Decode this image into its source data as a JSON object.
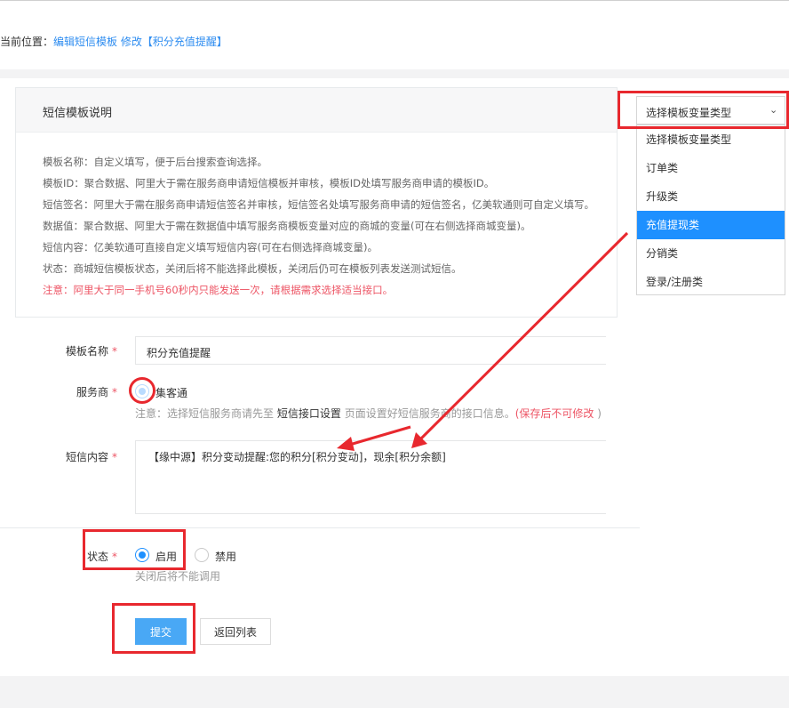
{
  "breadcrumb": {
    "prefix": "当前位置：",
    "path": "编辑短信模板 修改【积分充值提醒】"
  },
  "help": {
    "title": "短信模板说明",
    "lines": [
      "模板名称：自定义填写，便于后台搜索查询选择。",
      "模板ID：聚合数据、阿里大于需在服务商申请短信模板并审核，模板ID处填写服务商申请的模板ID。",
      "短信签名：阿里大于需在服务商申请短信签名并审核，短信签名处填写服务商申请的短信签名，亿美软通则可自定义填写。",
      "数据值：聚合数据、阿里大于需在数据值中填写服务商模板变量对应的商城的变量(可在右侧选择商城变量)。",
      "短信内容：亿美软通可直接自定义填写短信内容(可在右侧选择商城变量)。",
      "状态：商城短信模板状态，关闭后将不能选择此模板，关闭后仍可在模板列表发送测试短信。"
    ],
    "warning": "注意：阿里大于同一手机号60秒内只能发送一次，请根据需求选择适当接口。"
  },
  "variable_select": {
    "selected": "选择模板变量类型",
    "options": [
      "选择模板变量类型",
      "订单类",
      "升级类",
      "充值提现类",
      "分销类",
      "登录/注册类"
    ],
    "highlighted_option": "充值提现类"
  },
  "form": {
    "required_mark": "*",
    "name": {
      "label": "模板名称",
      "value": "积分充值提醒"
    },
    "provider": {
      "label": "服务商",
      "option": "集客通",
      "hint_prefix": "注意：选择短信服务商请先至",
      "hint_link": "短信接口设置",
      "hint_middle": "页面设置好短信服务商的接口信息。",
      "hint_warn": "(保存后不可修改",
      "hint_close": ")"
    },
    "content": {
      "label": "短信内容",
      "value": "【缘中源】积分变动提醒:您的积分[积分变动]，现余[积分余额]"
    },
    "status": {
      "label": "状态",
      "options": [
        "启用",
        "禁用"
      ],
      "selected": "启用",
      "hint": "关闭后将不能调用"
    }
  },
  "buttons": {
    "submit": "提交",
    "back": "返回列表"
  },
  "colors": {
    "primary": "#49a8f5",
    "accent": "#1e90ff",
    "annotation": "#e8282e",
    "warning": "#ed5565"
  }
}
